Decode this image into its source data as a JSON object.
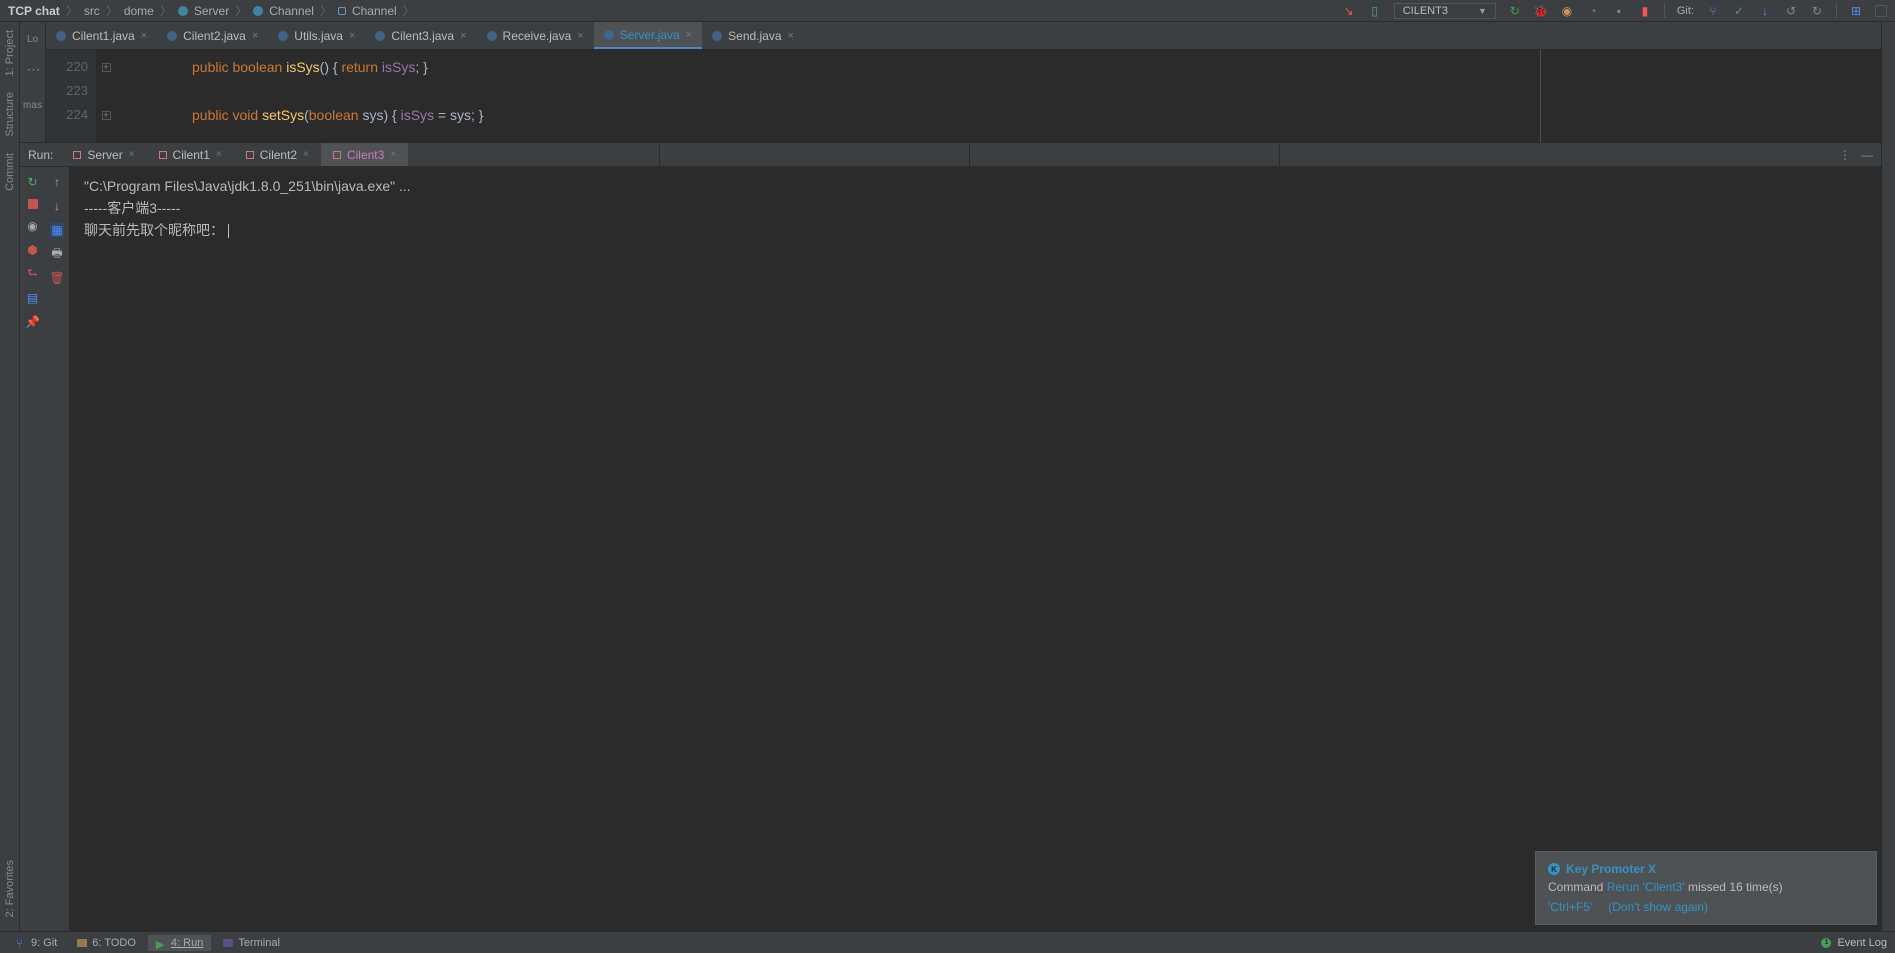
{
  "breadcrumb": {
    "project": "TCP chat",
    "items": [
      "src",
      "dome",
      "Server",
      "Channel",
      "Channel"
    ]
  },
  "toolbar": {
    "run_config": "CILENT3",
    "git_label": "Git:"
  },
  "editor_tabs": [
    {
      "name": "Cilent1.java",
      "active": false
    },
    {
      "name": "Cilent2.java",
      "active": false
    },
    {
      "name": "Utils.java",
      "active": false
    },
    {
      "name": "Cilent3.java",
      "active": false
    },
    {
      "name": "Receive.java",
      "active": false
    },
    {
      "name": "Server.java",
      "active": true
    },
    {
      "name": "Send.java",
      "active": false
    }
  ],
  "left_tools": {
    "commit": "Commit",
    "structure": "Structure",
    "project": "1: Project",
    "favorites": "2: Favorites"
  },
  "proj_panel": {
    "lo": "Lo",
    "mas": "mas"
  },
  "editor": {
    "lines": [
      "220",
      "223",
      "224"
    ],
    "code": {
      "l1": {
        "kw1": "public",
        "kw2": "boolean",
        "ident": "isSys",
        "paren1": "() { ",
        "kw3": "return",
        "var": " isSys",
        "paren2": "; }"
      },
      "l3": {
        "kw1": "public",
        "kw2": "void",
        "ident": "setSys",
        "paren1": "(",
        "kw3": "boolean",
        "var1": " sys",
        "paren2": ") { ",
        "var2": "isSys",
        "eq": " = ",
        "var3": "sys",
        "end": "; }"
      }
    }
  },
  "run_panel": {
    "label": "Run:",
    "tabs": [
      {
        "name": "Server",
        "active": false
      },
      {
        "name": "Cilent1",
        "active": false
      },
      {
        "name": "Cilent2",
        "active": false
      },
      {
        "name": "Cilent3",
        "active": true
      }
    ]
  },
  "console": {
    "line1": "\"C:\\Program Files\\Java\\jdk1.8.0_251\\bin\\java.exe\" ...",
    "line2": "-----客户端3-----",
    "line3": "聊天前先取个昵称吧："
  },
  "notification": {
    "title": "Key Promoter X",
    "prefix": "Command ",
    "link": "Rerun 'Cilent3'",
    "suffix": " missed 16 time(s)",
    "shortcut": "'Ctrl+F5'",
    "dismiss": "(Don't show again)"
  },
  "bottom_bar": {
    "git": "9: Git",
    "todo": "6: TODO",
    "run": "4: Run",
    "terminal": "Terminal",
    "event_log": "Event Log"
  }
}
